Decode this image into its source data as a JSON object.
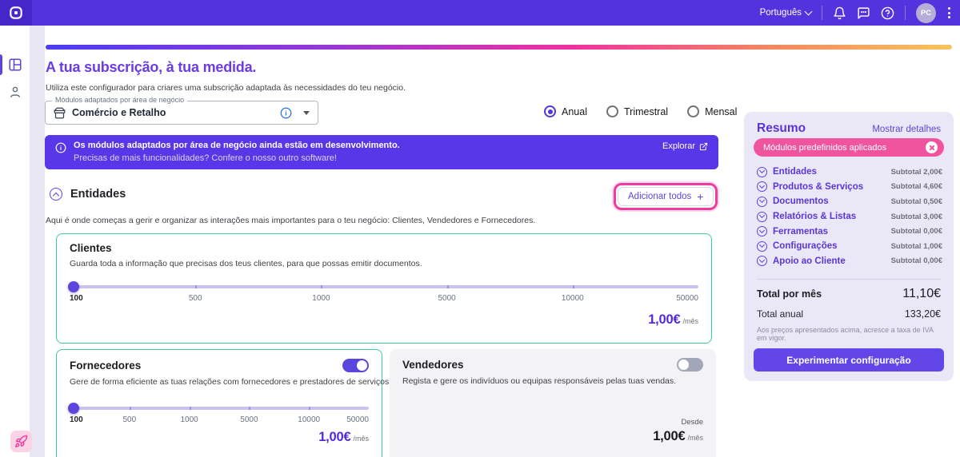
{
  "topbar": {
    "language": "Português",
    "avatar_initials": "PC"
  },
  "page": {
    "title": "A tua subscrição, à tua medida.",
    "subtitle": "Utiliza este configurador para criares uma subscrição adaptada às necessidades do teu negócio."
  },
  "module_select": {
    "label": "Módulos adaptados por área de negócio",
    "value": "Comércio e Retalho"
  },
  "billing_options": [
    {
      "label": "Anual",
      "selected": true
    },
    {
      "label": "Trimestral",
      "selected": false
    },
    {
      "label": "Mensal",
      "selected": false
    }
  ],
  "banner": {
    "title": "Os módulos adaptados por área de negócio ainda estão em desenvolvimento.",
    "subtitle": "Precisas de mais funcionalidades? Confere o nosso outro software!",
    "action": "Explorar"
  },
  "entities_section": {
    "title": "Entidades",
    "add_all_label": "Adicionar todos",
    "add_all_plus": "+",
    "description": "Aqui é onde começas a gerir e organizar as interações mais importantes para o teu negócio: Clientes, Vendedores e Fornecedores."
  },
  "cards": {
    "clientes": {
      "title": "Clientes",
      "description": "Guarda toda a informação que precisas dos teus clientes, para que possas emitir documentos.",
      "ticks": [
        "100",
        "500",
        "1000",
        "5000",
        "10000",
        "50000"
      ],
      "slider_value": "100",
      "price": "1,00€",
      "price_unit": "/mês"
    },
    "fornecedores": {
      "title": "Fornecedores",
      "description": "Gere de forma eficiente as tuas relações com fornecedores e prestadores de serviços.",
      "toggle_on": true,
      "ticks": [
        "100",
        "500",
        "1000",
        "5000",
        "10000",
        "50000"
      ],
      "slider_value": "100",
      "price": "1,00€",
      "price_unit": "/mês"
    },
    "vendedores": {
      "title": "Vendedores",
      "description": "Regista e gere os indivíduos ou equipas responsáveis pelas tuas vendas.",
      "toggle_on": false,
      "price_prefix": "Desde",
      "price": "1,00€",
      "price_unit": "/mês"
    }
  },
  "summary": {
    "title": "Resumo",
    "details_link": "Mostrar detalhes",
    "badge": "Módulos predefinidos aplicados",
    "items": [
      {
        "label": "Entidades",
        "subtotal": "Subtotal 2,00€"
      },
      {
        "label": "Produtos & Serviços",
        "subtotal": "Subtotal 4,60€"
      },
      {
        "label": "Documentos",
        "subtotal": "Subtotal 0,50€"
      },
      {
        "label": "Relatórios & Listas",
        "subtotal": "Subtotal 3,00€"
      },
      {
        "label": "Ferramentas",
        "subtotal": "Subtotal 0,00€"
      },
      {
        "label": "Configurações",
        "subtotal": "Subtotal 1,00€"
      },
      {
        "label": "Apoio ao Cliente",
        "subtotal": "Subtotal 0,00€"
      }
    ],
    "total_month_label": "Total por mês",
    "total_month_value": "11,10€",
    "total_year_label": "Total anual",
    "total_year_value": "133,20€",
    "vat_note": "Aos preços apresentados acima, acresce a taxa de IVA em vigor.",
    "cta": "Experimentar configuração"
  },
  "colors": {
    "topbar": "#5233dd",
    "accent_purple": "#5b45dd",
    "heading_purple": "#6c3be2",
    "banner_purple": "#5737e8",
    "pink": "#f1549f",
    "highlight_ring_pink": "#ee3ba2",
    "card_border_green": "#3ec9a7",
    "summary_bg": "#eae8f6",
    "price_purple": "#5328d8",
    "gradient": [
      "#4b3cf2",
      "#ef31a0",
      "#f7c45c"
    ]
  }
}
